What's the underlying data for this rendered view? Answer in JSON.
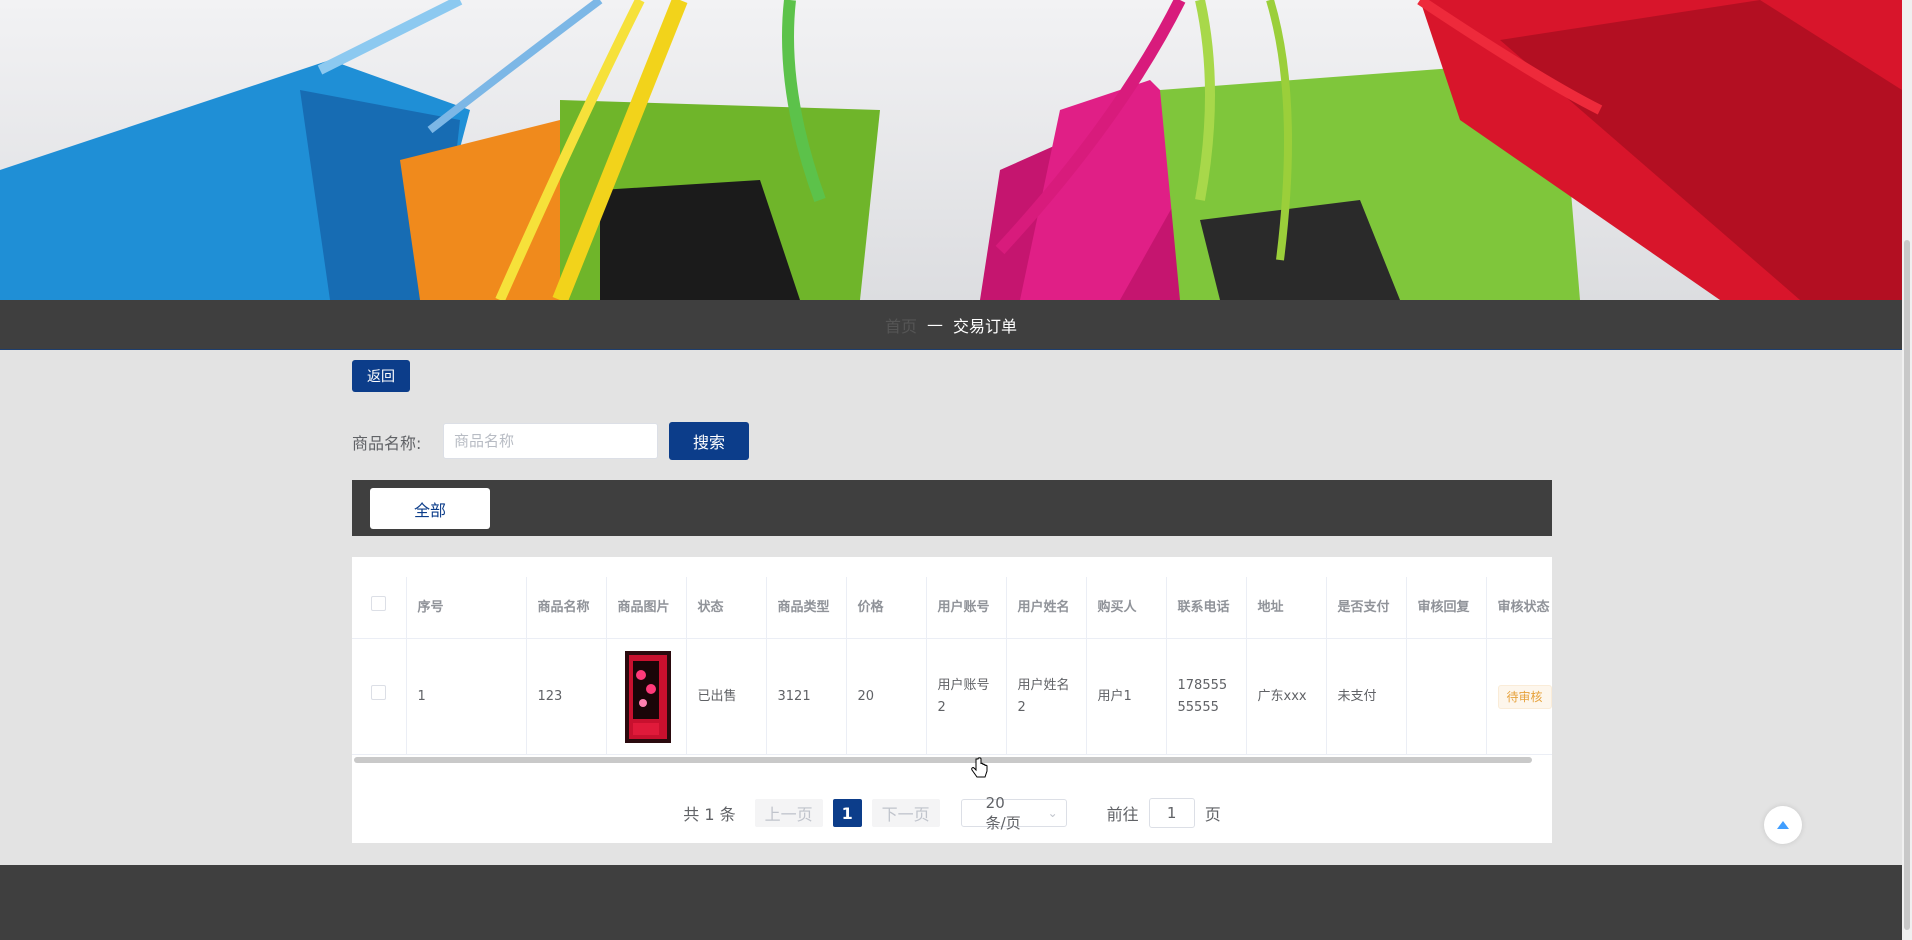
{
  "breadcrumb": {
    "home": "首页",
    "separator": "—",
    "current": "交易订单"
  },
  "actions": {
    "back_label": "返回"
  },
  "search": {
    "label": "商品名称:",
    "placeholder": "商品名称",
    "button_label": "搜索"
  },
  "tabs": [
    {
      "label": "全部"
    }
  ],
  "table": {
    "headers": [
      "序号",
      "商品名称",
      "商品图片",
      "状态",
      "商品类型",
      "价格",
      "用户账号",
      "用户姓名",
      "购买人",
      "联系电话",
      "地址",
      "是否支付",
      "审核回复",
      "审核状态"
    ],
    "rows": [
      {
        "index": "1",
        "product_name": "123",
        "status": "已出售",
        "product_type": "3121",
        "price": "20",
        "user_account": "用户账号2",
        "user_name": "用户姓名2",
        "buyer": "用户1",
        "phone": "17855555555",
        "address": "广东xxx",
        "paid": "未支付",
        "review_reply": "",
        "review_status": "待审核"
      }
    ]
  },
  "pagination": {
    "total": "共 1 条",
    "prev": "上一页",
    "current": "1",
    "next": "下一页",
    "page_size": "20条/页",
    "goto_label": "前往",
    "goto_value": "1",
    "page_unit": "页"
  },
  "colors": {
    "primary": "#0c3d8a",
    "dark_bar": "#3f3f3f",
    "warning": "#e6a23c"
  },
  "icons": {
    "back_to_top": "caret-up-icon",
    "dropdown": "chevron-down-icon"
  }
}
